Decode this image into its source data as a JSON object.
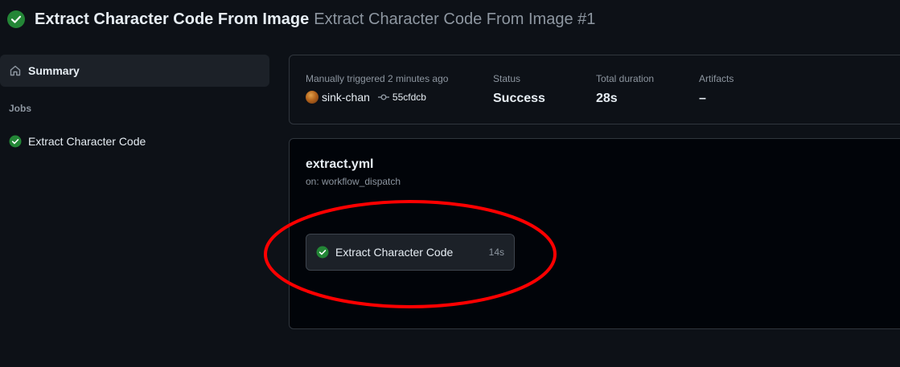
{
  "header": {
    "title": "Extract Character Code From Image",
    "run_name": "Extract Character Code From Image #1",
    "status_icon": "check-circle-fill-icon"
  },
  "sidebar": {
    "summary_label": "Summary",
    "summary_icon": "home-icon",
    "jobs_heading": "Jobs",
    "jobs": [
      {
        "label": "Extract Character Code",
        "status_icon": "check-circle-fill-icon"
      }
    ]
  },
  "summary": {
    "trigger_label": "Manually triggered 2 minutes ago",
    "actor": "sink-chan",
    "commit": "55cfdcb",
    "status_label": "Status",
    "status_value": "Success",
    "duration_label": "Total duration",
    "duration_value": "28s",
    "artifacts_label": "Artifacts",
    "artifacts_value": "–"
  },
  "workflow": {
    "file": "extract.yml",
    "trigger": "on: workflow_dispatch",
    "job": {
      "label": "Extract Character Code",
      "duration": "14s",
      "status_icon": "check-circle-fill-icon"
    }
  },
  "colors": {
    "success": "#238636",
    "annotation": "#ff0000",
    "background": "#0d1117"
  }
}
